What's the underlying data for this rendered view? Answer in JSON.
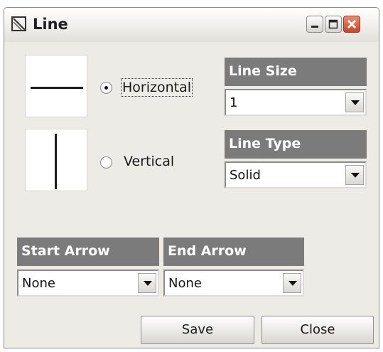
{
  "window": {
    "title": "Line",
    "icon": "line-tool-icon",
    "controls": [
      "minimize-icon",
      "maximize-icon",
      "close-icon"
    ]
  },
  "orientation": {
    "selected": "Horizontal",
    "options": [
      {
        "label": "Horizontal",
        "checked": true
      },
      {
        "label": "Vertical",
        "checked": false
      }
    ]
  },
  "line_size": {
    "header": "Line Size",
    "value": "1"
  },
  "line_type": {
    "header": "Line Type",
    "value": "Solid"
  },
  "start_arrow": {
    "header": "Start Arrow",
    "value": "None"
  },
  "end_arrow": {
    "header": "End Arrow",
    "value": "None"
  },
  "buttons": {
    "save": "Save",
    "close": "Close"
  },
  "colors": {
    "header_bg": "#7b7b7b",
    "panel_bg": "#ecebe6",
    "close_button": "#c8452a"
  }
}
